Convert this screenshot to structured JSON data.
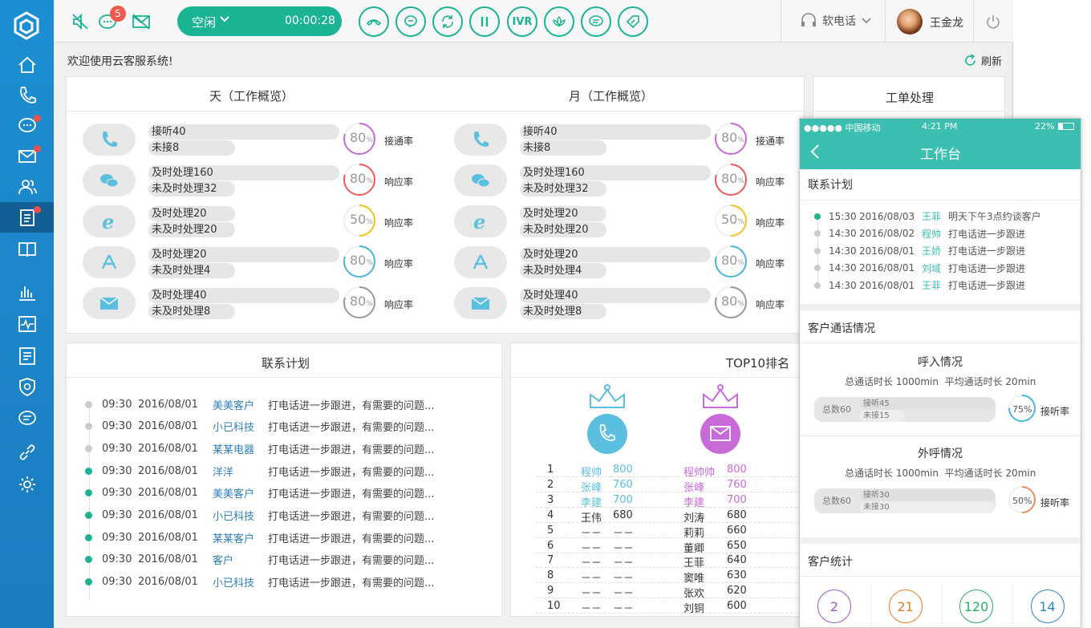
{
  "topbar": {
    "badge_count": "5",
    "status": "空闲",
    "timer": "00:00:28",
    "ivr": "IVR",
    "softphone": "软电话",
    "username": "王金龙"
  },
  "welcome": "欢迎使用云客服系统!",
  "refresh": "刷新",
  "day_panel": {
    "title": "天（工作概览）",
    "rows": [
      {
        "icon": "phone-icon",
        "a": "接听40",
        "b": "未接8",
        "pct": "80",
        "unit": "%",
        "label": "接通率",
        "color": "#c86bd9"
      },
      {
        "icon": "wechat-icon",
        "a": "及时处理160",
        "b": "未及时处理32",
        "pct": "80",
        "unit": "%",
        "label": "响应率",
        "color": "#ef5b5b"
      },
      {
        "icon": "ie-icon",
        "a": "及时处理20",
        "b": "未及时处理20",
        "pct": "50",
        "unit": "%",
        "label": "响应率",
        "color": "#f3c41a"
      },
      {
        "icon": "appstore-icon",
        "a": "及时处理20",
        "b": "未及时处理4",
        "pct": "80",
        "unit": "%",
        "label": "响应率",
        "color": "#49b7d8"
      },
      {
        "icon": "mail-icon",
        "a": "及时处理40",
        "b": "未及时处理8",
        "pct": "80",
        "unit": "%",
        "label": "响应率",
        "color": "#999999"
      }
    ]
  },
  "month_panel": {
    "title": "月（工作概览）",
    "rows": [
      {
        "icon": "phone-icon",
        "a": "接听40",
        "b": "未接8",
        "pct": "80",
        "unit": "%",
        "label": "接通率",
        "color": "#c86bd9"
      },
      {
        "icon": "wechat-icon",
        "a": "及时处理160",
        "b": "未及时处理32",
        "pct": "80",
        "unit": "%",
        "label": "响应率",
        "color": "#ef5b5b"
      },
      {
        "icon": "ie-icon",
        "a": "及时处理20",
        "b": "未及时处理20",
        "pct": "50",
        "unit": "%",
        "label": "响应率",
        "color": "#f3c41a"
      },
      {
        "icon": "appstore-icon",
        "a": "及时处理20",
        "b": "未及时处理4",
        "pct": "80",
        "unit": "%",
        "label": "响应率",
        "color": "#49b7d8"
      },
      {
        "icon": "mail-icon",
        "a": "及时处理40",
        "b": "未及时处理8",
        "pct": "80",
        "unit": "%",
        "label": "响应率",
        "color": "#999999"
      }
    ]
  },
  "ticket_panel": {
    "title": "工单处理"
  },
  "plan_panel": {
    "title": "联系计划",
    "rows": [
      {
        "time": "09:30",
        "date": "2016/08/01",
        "name": "美美客户",
        "text": "打电话进一步跟进，有需要的问题...",
        "done": false
      },
      {
        "time": "09:30",
        "date": "2016/08/01",
        "name": "小已科技",
        "text": "打电话进一步跟进，有需要的问题...",
        "done": false
      },
      {
        "time": "09:30",
        "date": "2016/08/01",
        "name": "某某电器",
        "text": "打电话进一步跟进，有需要的问题...",
        "done": false
      },
      {
        "time": "09:30",
        "date": "2016/08/01",
        "name": "洋洋",
        "text": "打电话进一步跟进，有需要的问题...",
        "done": true
      },
      {
        "time": "09:30",
        "date": "2016/08/01",
        "name": "美美客户",
        "text": "打电话进一步跟进，有需要的问题...",
        "done": true
      },
      {
        "time": "09:30",
        "date": "2016/08/01",
        "name": "小已科技",
        "text": "打电话进一步跟进，有需要的问题...",
        "done": true
      },
      {
        "time": "09:30",
        "date": "2016/08/01",
        "name": "某某客户",
        "text": "打电话进一步跟进，有需要的问题...",
        "done": true
      },
      {
        "time": "09:30",
        "date": "2016/08/01",
        "name": "客户",
        "text": "打电话进一步跟进，有需要的问题...",
        "done": true
      },
      {
        "time": "09:30",
        "date": "2016/08/01",
        "name": "小已科技",
        "text": "打电话进一步跟进，有需要的问题...",
        "done": true
      }
    ]
  },
  "top10_panel": {
    "title": "TOP10排名",
    "rows": [
      {
        "rank": "1",
        "n1": "程帅",
        "v1": "800",
        "n2": "程帅帅",
        "v2": "800"
      },
      {
        "rank": "2",
        "n1": "张峰",
        "v1": "760",
        "n2": "张峰",
        "v2": "760"
      },
      {
        "rank": "3",
        "n1": "李建",
        "v1": "700",
        "n2": "李建",
        "v2": "700"
      },
      {
        "rank": "4",
        "n1": "王伟",
        "v1": "680",
        "n2": "刘涛",
        "v2": "680"
      },
      {
        "rank": "5",
        "n1": "－－",
        "v1": "－－",
        "n2": "莉莉",
        "v2": "660"
      },
      {
        "rank": "6",
        "n1": "－－",
        "v1": "－－",
        "n2": "董卿",
        "v2": "650"
      },
      {
        "rank": "7",
        "n1": "－－",
        "v1": "－－",
        "n2": "王菲",
        "v2": "640"
      },
      {
        "rank": "8",
        "n1": "－－",
        "v1": "－－",
        "n2": "窦唯",
        "v2": "630"
      },
      {
        "rank": "9",
        "n1": "－－",
        "v1": "－－",
        "n2": "张欢",
        "v2": "620"
      },
      {
        "rank": "10",
        "n1": "－－",
        "v1": "－－",
        "n2": "刘铜",
        "v2": "600"
      }
    ]
  },
  "phone": {
    "carrier": "●●●●● 中国移动",
    "clock": "4:21 PM",
    "battery": "22%",
    "header": "工作台",
    "plan_title": "联系计划",
    "plans": [
      {
        "time": "15:30",
        "date": "2016/08/03",
        "name": "王菲",
        "text": "明天下午3点约谈客户",
        "active": true
      },
      {
        "time": "14:30",
        "date": "2016/08/02",
        "name": "程帅",
        "text": "打电话进一步跟进",
        "active": false
      },
      {
        "time": "14:30",
        "date": "2016/08/01",
        "name": "王娇",
        "text": "打电话进一步跟进",
        "active": false
      },
      {
        "time": "14:30",
        "date": "2016/08/01",
        "name": "刘域",
        "text": "打电话进一步跟进",
        "active": false
      },
      {
        "time": "14:30",
        "date": "2016/08/01",
        "name": "王菲",
        "text": "打电话进一步跟进",
        "active": false
      }
    ],
    "calls_title": "客户通话情况",
    "incoming": {
      "title": "呼入情况",
      "summary": "总通话时长 1000min  平均通话时长 20min",
      "total": "总数60",
      "a": "接听45",
      "b": "未接15",
      "pct": "75%",
      "label": "接听率"
    },
    "outgoing": {
      "title": "外呼情况",
      "summary": "总通话时长 1000min  平均通话时长 20min",
      "total": "总数60",
      "a": "接听30",
      "b": "未接30",
      "pct": "50%",
      "label": "接听率"
    },
    "stats_title": "客户统计",
    "stats": [
      {
        "value": "2",
        "color": "#9b59b6"
      },
      {
        "value": "21",
        "color": "#e67e22"
      },
      {
        "value": "120",
        "color": "#27ae60"
      },
      {
        "value": "14",
        "color": "#2e86c1"
      }
    ]
  }
}
